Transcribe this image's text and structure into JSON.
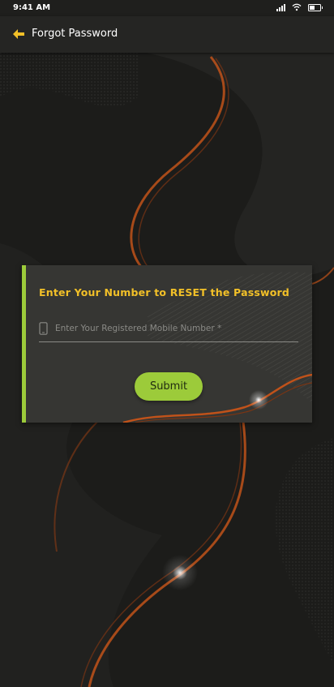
{
  "status_bar": {
    "time": "9:41 AM",
    "icons": [
      "signal-icon",
      "wifi-icon",
      "battery-icon"
    ]
  },
  "app_bar": {
    "title": "Forgot Password",
    "back_icon": "arrow-left-icon",
    "back_icon_color": "#f2c028"
  },
  "reset_card": {
    "title": "Enter Your Number to RESET the Password",
    "mobile_input": {
      "value": "",
      "placeholder": "Enter Your Registered Mobile Number *",
      "icon": "phone-icon"
    },
    "submit_label": "Submit"
  },
  "colors": {
    "accent_green": "#9ccb3a",
    "title_yellow": "#f2c028",
    "background": "#1c1c1a",
    "card": "#363633",
    "wave_orange": "#c0521a"
  }
}
